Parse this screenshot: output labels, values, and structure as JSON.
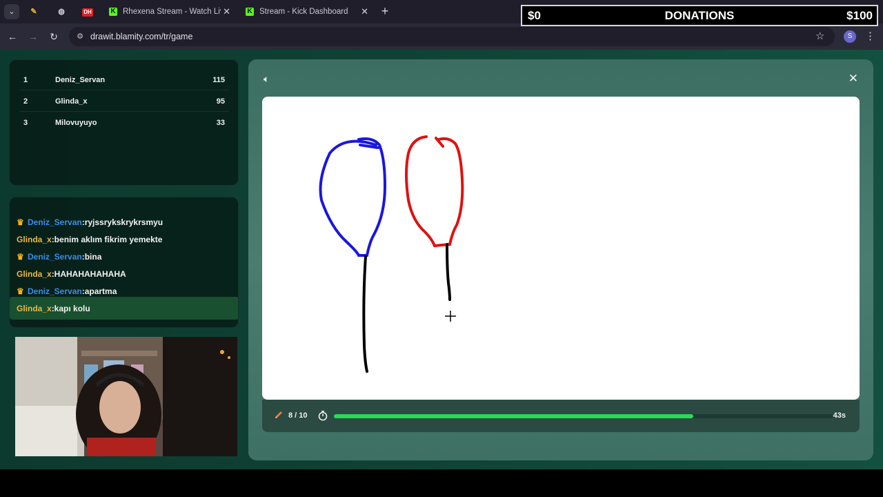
{
  "browser": {
    "tabs": [
      {
        "label": "Rhexena Stream - Watch Live o"
      },
      {
        "label": "Stream - Kick Dashboard"
      }
    ],
    "pinned": [
      "DH"
    ],
    "url": "drawit.blamity.com/tr/game",
    "profile_initial": "S"
  },
  "donations": {
    "left": "$0",
    "title": "DONATIONS",
    "right": "$100"
  },
  "leaderboard": [
    {
      "rank": "1",
      "name": "Deniz_Servan",
      "points": "115"
    },
    {
      "rank": "2",
      "name": "Glinda_x",
      "points": "95"
    },
    {
      "rank": "3",
      "name": "Milovuyuyo",
      "points": "33"
    }
  ],
  "chat": [
    {
      "user": "Deniz_Servan",
      "crown": true,
      "message": ":ryjssrykskrykrsmyu"
    },
    {
      "user": "Glinda_x",
      "crown": false,
      "message": ":benim aklım fikrim yemekte"
    },
    {
      "user": "Deniz_Servan",
      "crown": true,
      "message": ":bina"
    },
    {
      "user": "Glinda_x",
      "crown": false,
      "message": ":HAHAHAHAHAHA"
    },
    {
      "user": "Deniz_Servan",
      "crown": true,
      "message": ":apartma"
    },
    {
      "user": "Glinda_x",
      "crown": false,
      "message": ":kapı kolu"
    }
  ],
  "game": {
    "round": "8 / 10",
    "time_left": "43s",
    "progress": 0.72
  },
  "colors": {
    "kick_green": "#53fc18",
    "progress_green": "#2bd857",
    "balloon_blue": "#1a16e0",
    "balloon_red": "#e01010"
  }
}
